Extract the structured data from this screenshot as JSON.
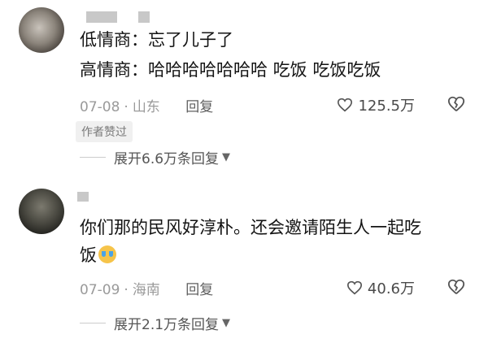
{
  "comments": [
    {
      "lines": [
        "低情商：忘了儿子了",
        "高情商：哈哈哈哈哈哈哈 吃饭 吃饭吃饭"
      ],
      "date": "07-08",
      "location": "山东",
      "reply_label": "回复",
      "likes": "125.5万",
      "author_badge": "作者赞过",
      "expand_label": "展开6.6万条回复"
    },
    {
      "lines": [
        "你们那的民风好淳朴。还会邀请陌生人一起吃",
        "饭"
      ],
      "date": "07-09",
      "location": "海南",
      "reply_label": "回复",
      "likes": "40.6万",
      "expand_label": "展开2.1万条回复"
    }
  ],
  "icons": {
    "like": "heart-outline-icon",
    "dislike": "broken-heart-outline-icon",
    "expand": "chevron-down-icon",
    "emoji": "crying-face-emoji"
  }
}
